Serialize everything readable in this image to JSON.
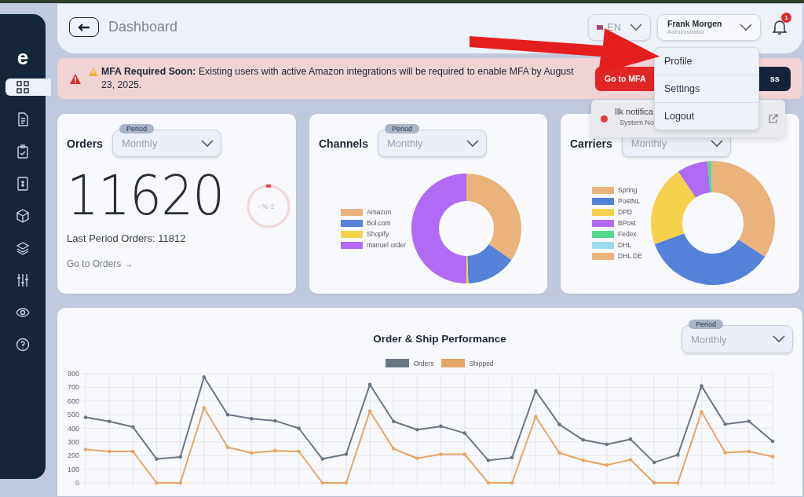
{
  "sidebar": {
    "logo": "e",
    "items": [
      {
        "kind": "grid",
        "selected": true
      },
      {
        "kind": "document",
        "selected": false
      },
      {
        "kind": "clipboard",
        "selected": false
      },
      {
        "kind": "invoice",
        "selected": false
      },
      {
        "kind": "box",
        "selected": false
      },
      {
        "kind": "layers",
        "selected": false
      },
      {
        "kind": "sliders",
        "selected": false
      },
      {
        "kind": "eye",
        "selected": false
      },
      {
        "kind": "help",
        "selected": false
      }
    ]
  },
  "header": {
    "title": "Dashboard",
    "language": "EN",
    "user": {
      "name": "Frank Morgen",
      "role": "Administrator"
    },
    "notification_badge": "1"
  },
  "alert": {
    "text": "**MFA Required Soon:** Existing users with active Amazon integrations will be required to enable MFA by August 23, 2025.",
    "buttons": [
      {
        "label": "Go to MFA",
        "kind": "primary"
      },
      {
        "label": "ss",
        "kind": "dark"
      }
    ]
  },
  "orders_card": {
    "title": "Orders",
    "period": {
      "label": "Period",
      "value": "Monthly"
    },
    "total": "11620",
    "change": "- %-2",
    "last_period": "Last Period Orders: 11812",
    "link": "Go to Orders →"
  },
  "channels_card": {
    "title": "Channels",
    "period": {
      "label": "Period",
      "value": "Monthly"
    },
    "legend": [
      {
        "name": "Amazon",
        "color": "#e9b37b"
      },
      {
        "name": "Bol.com",
        "color": "#5581d8"
      },
      {
        "name": "Shopify",
        "color": "#f6d24c"
      },
      {
        "name": "manuel order",
        "color": "#b06af5"
      }
    ]
  },
  "carriers_card": {
    "title": "Carriers",
    "period": {
      "value": "Monthly"
    },
    "legend": [
      {
        "name": "Spring",
        "color": "#e9b37b"
      },
      {
        "name": "PostNL",
        "color": "#5581d8"
      },
      {
        "name": "DPD",
        "color": "#f6d24c"
      },
      {
        "name": "BPost",
        "color": "#b06af5"
      },
      {
        "name": "Fedex",
        "color": "#52d98c"
      },
      {
        "name": "DHL",
        "color": "#9cdcf0"
      },
      {
        "name": "DHL DE",
        "color": "#e9b37b"
      }
    ]
  },
  "performance": {
    "title": "Order & Ship Performance",
    "period": {
      "label": "Period",
      "value": "Monthly"
    },
    "chart_data": {
      "type": "line",
      "grid": true,
      "ylim": [
        0,
        800
      ],
      "yticks": [
        0,
        100,
        200,
        300,
        400,
        500,
        600,
        700,
        800
      ],
      "series": [
        {
          "name": "Orders",
          "color": "#6b7685",
          "values": [
            480,
            450,
            410,
            175,
            190,
            775,
            500,
            470,
            455,
            400,
            175,
            210,
            720,
            450,
            390,
            415,
            365,
            165,
            185,
            675,
            428,
            315,
            282,
            320,
            150,
            205,
            710,
            430,
            452,
            305
          ]
        },
        {
          "name": "Shipped",
          "color": "#e8a465",
          "values": [
            245,
            230,
            230,
            0,
            0,
            550,
            260,
            220,
            235,
            230,
            0,
            0,
            525,
            250,
            180,
            210,
            210,
            0,
            0,
            485,
            220,
            165,
            130,
            170,
            0,
            0,
            520,
            222,
            230,
            192
          ]
        }
      ]
    }
  },
  "user_menu": {
    "items": [
      {
        "label": "Profile"
      },
      {
        "label": "Settings"
      },
      {
        "label": "Logout"
      }
    ]
  },
  "notification_panel": {
    "title": "Ilk notifica",
    "subtitle": "System No"
  }
}
